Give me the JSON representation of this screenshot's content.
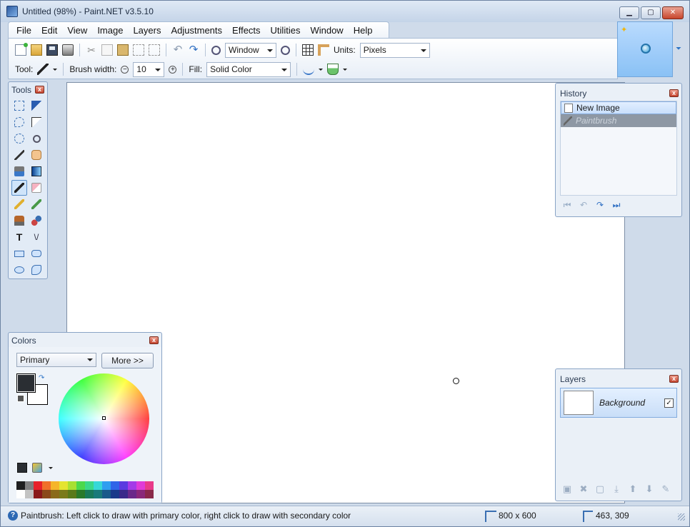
{
  "window": {
    "title": "Untitled (98%) - Paint.NET v3.5.10",
    "buttons": {
      "minimize": "▁",
      "maximize": "▢",
      "close": "✕"
    }
  },
  "menu": [
    "File",
    "Edit",
    "View",
    "Image",
    "Layers",
    "Adjustments",
    "Effects",
    "Utilities",
    "Window",
    "Help"
  ],
  "toolbar": {
    "zoom_mode": "Window",
    "units_label": "Units:",
    "units_value": "Pixels",
    "tool_label": "Tool:",
    "brush_width_label": "Brush width:",
    "brush_width_value": "10",
    "fill_label": "Fill:",
    "fill_value": "Solid Color",
    "icons": [
      "new-image-icon",
      "open-icon",
      "save-icon",
      "print-icon",
      "cut-icon",
      "copy-icon",
      "paste-icon",
      "crop-icon",
      "deselect-icon",
      "undo-icon",
      "redo-icon",
      "zoom-out-icon",
      "zoom-in-icon",
      "grid-icon",
      "ruler-icon"
    ]
  },
  "tools_panel": {
    "title": "Tools",
    "close": "x",
    "tools": [
      "rectangle-select",
      "move-selected-pixels",
      "lasso-select",
      "move-selection",
      "ellipse-select",
      "zoom",
      "magic-wand",
      "pan",
      "paint-bucket",
      "gradient",
      "paintbrush",
      "eraser",
      "pencil",
      "color-picker",
      "clone-stamp",
      "recolor",
      "text",
      "line-curve",
      "rectangle",
      "rounded-rectangle",
      "ellipse",
      "freeform-shape"
    ],
    "active_tool": "paintbrush"
  },
  "colors_panel": {
    "title": "Colors",
    "close": "x",
    "mode": "Primary",
    "more_button": "More >>",
    "primary_color": "#2a2e33",
    "secondary_color": "#ffffff",
    "palette_row1": [
      "#1f1f1f",
      "#7f7f7f",
      "#e8202a",
      "#f06f2a",
      "#f5b52a",
      "#e5e430",
      "#a8e032",
      "#4cd84c",
      "#3ad88a",
      "#36d8d8",
      "#2f9ef0",
      "#3064e8",
      "#5a3ae0",
      "#a43ae8",
      "#e03ad8",
      "#e83a8a"
    ],
    "palette_row2": [
      "#ffffff",
      "#c3c3c3",
      "#8a1a1a",
      "#8a4a1a",
      "#8a6a1a",
      "#7a7a1a",
      "#5a7a1a",
      "#2a7a2a",
      "#1a7a5a",
      "#1a7a7a",
      "#1a5a8a",
      "#1a3a8a",
      "#3a2a8a",
      "#6a2a8a",
      "#8a2a7a",
      "#8a2a4a"
    ]
  },
  "history_panel": {
    "title": "History",
    "close": "x",
    "items": [
      {
        "label": "New Image",
        "state": "selected"
      },
      {
        "label": "Paintbrush",
        "state": "undone"
      }
    ]
  },
  "layers_panel": {
    "title": "Layers",
    "close": "x",
    "layers": [
      {
        "name": "Background",
        "visible": true
      }
    ]
  },
  "status": {
    "help_text": "Paintbrush: Left click to draw with primary color, right click to draw with secondary color",
    "image_size": "800 x 600",
    "cursor_position": "463, 309"
  }
}
